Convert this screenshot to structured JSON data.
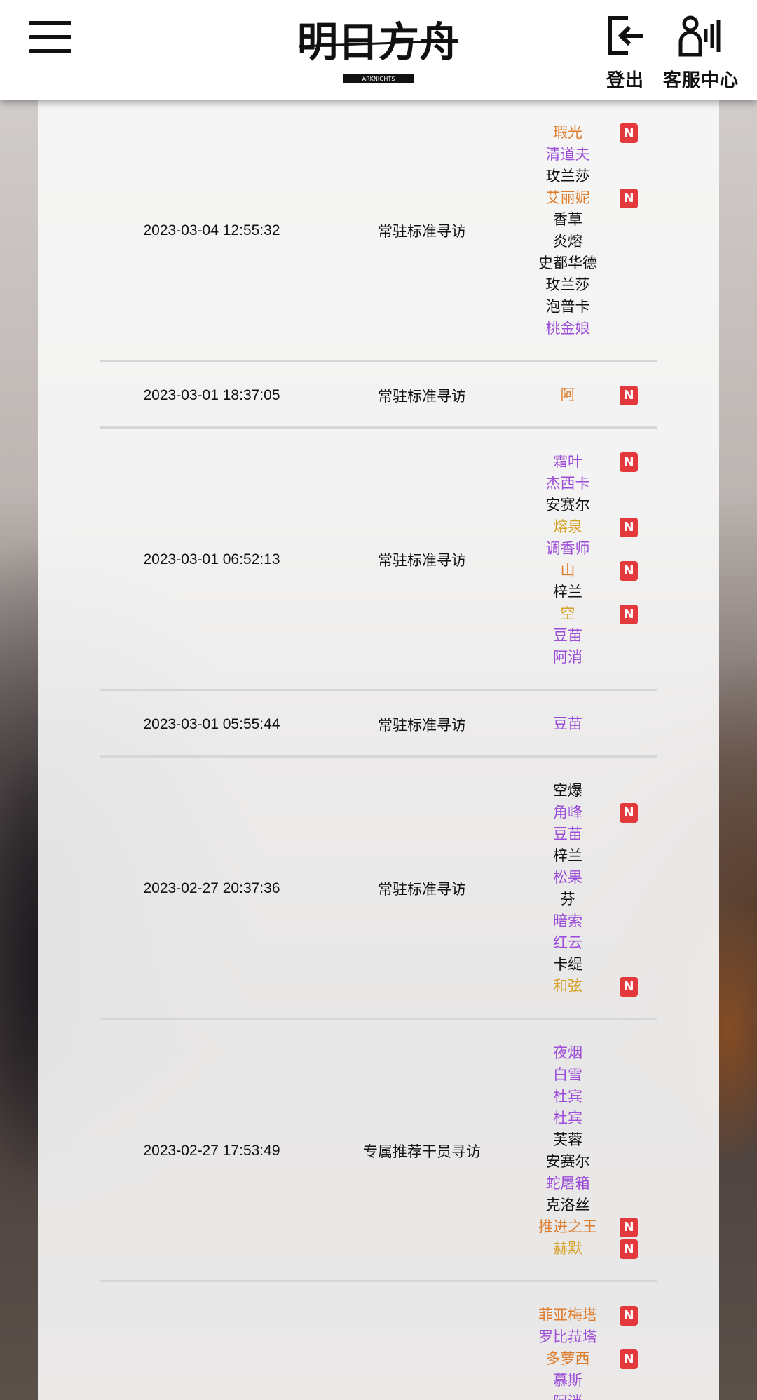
{
  "header": {
    "logo_text": "明日方舟",
    "logo_sub": "ARKNIGHTS",
    "logout_label": "登出",
    "service_label": "客服中心"
  },
  "colors": {
    "six_star": "#de7d2c",
    "five_star": "#d6a024",
    "four_star": "#9c4dd8",
    "three_star": "#111111",
    "new_badge": "#e4393c"
  },
  "new_badge_label": "N",
  "records": [
    {
      "time": "2023-03-04 12:55:32",
      "pool": "常驻标准寻访",
      "ops": [
        {
          "name": "瑕光",
          "rarity": 6,
          "new": true
        },
        {
          "name": "清道夫",
          "rarity": 4,
          "new": false
        },
        {
          "name": "玫兰莎",
          "rarity": 3,
          "new": false
        },
        {
          "name": "艾丽妮",
          "rarity": 6,
          "new": true
        },
        {
          "name": "香草",
          "rarity": 3,
          "new": false
        },
        {
          "name": "炎熔",
          "rarity": 3,
          "new": false
        },
        {
          "name": "史都华德",
          "rarity": 3,
          "new": false
        },
        {
          "name": "玫兰莎",
          "rarity": 3,
          "new": false
        },
        {
          "name": "泡普卡",
          "rarity": 3,
          "new": false
        },
        {
          "name": "桃金娘",
          "rarity": 4,
          "new": false
        }
      ]
    },
    {
      "time": "2023-03-01 18:37:05",
      "pool": "常驻标准寻访",
      "ops": [
        {
          "name": "阿",
          "rarity": 6,
          "new": true
        }
      ]
    },
    {
      "time": "2023-03-01 06:52:13",
      "pool": "常驻标准寻访",
      "ops": [
        {
          "name": "霜叶",
          "rarity": 4,
          "new": true
        },
        {
          "name": "杰西卡",
          "rarity": 4,
          "new": false
        },
        {
          "name": "安赛尔",
          "rarity": 3,
          "new": false
        },
        {
          "name": "熔泉",
          "rarity": 5,
          "new": true
        },
        {
          "name": "调香师",
          "rarity": 4,
          "new": false
        },
        {
          "name": "山",
          "rarity": 6,
          "new": true
        },
        {
          "name": "梓兰",
          "rarity": 3,
          "new": false
        },
        {
          "name": "空",
          "rarity": 5,
          "new": true
        },
        {
          "name": "豆苗",
          "rarity": 4,
          "new": false
        },
        {
          "name": "阿消",
          "rarity": 4,
          "new": false
        }
      ]
    },
    {
      "time": "2023-03-01 05:55:44",
      "pool": "常驻标准寻访",
      "ops": [
        {
          "name": "豆苗",
          "rarity": 4,
          "new": false
        }
      ]
    },
    {
      "time": "2023-02-27 20:37:36",
      "pool": "常驻标准寻访",
      "ops": [
        {
          "name": "空爆",
          "rarity": 3,
          "new": false
        },
        {
          "name": "角峰",
          "rarity": 4,
          "new": true
        },
        {
          "name": "豆苗",
          "rarity": 4,
          "new": false
        },
        {
          "name": "梓兰",
          "rarity": 3,
          "new": false
        },
        {
          "name": "松果",
          "rarity": 4,
          "new": false
        },
        {
          "name": "芬",
          "rarity": 3,
          "new": false
        },
        {
          "name": "暗索",
          "rarity": 4,
          "new": false
        },
        {
          "name": "红云",
          "rarity": 4,
          "new": false
        },
        {
          "name": "卡缇",
          "rarity": 3,
          "new": false
        },
        {
          "name": "和弦",
          "rarity": 5,
          "new": true
        }
      ]
    },
    {
      "time": "2023-02-27 17:53:49",
      "pool": "专属推荐干员寻访",
      "ops": [
        {
          "name": "夜烟",
          "rarity": 4,
          "new": false
        },
        {
          "name": "白雪",
          "rarity": 4,
          "new": false
        },
        {
          "name": "杜宾",
          "rarity": 4,
          "new": false
        },
        {
          "name": "杜宾",
          "rarity": 4,
          "new": false
        },
        {
          "name": "芙蓉",
          "rarity": 3,
          "new": false
        },
        {
          "name": "安赛尔",
          "rarity": 3,
          "new": false
        },
        {
          "name": "蛇屠箱",
          "rarity": 4,
          "new": false
        },
        {
          "name": "克洛丝",
          "rarity": 3,
          "new": false
        },
        {
          "name": "推进之王",
          "rarity": 6,
          "new": true
        },
        {
          "name": "赫默",
          "rarity": 5,
          "new": true
        }
      ]
    },
    {
      "time": "",
      "pool": "",
      "ops": [
        {
          "name": "菲亚梅塔",
          "rarity": 6,
          "new": true
        },
        {
          "name": "罗比菈塔",
          "rarity": 4,
          "new": false
        },
        {
          "name": "多萝西",
          "rarity": 6,
          "new": true
        },
        {
          "name": "慕斯",
          "rarity": 4,
          "new": false
        },
        {
          "name": "阿消",
          "rarity": 4,
          "new": false
        }
      ]
    }
  ]
}
